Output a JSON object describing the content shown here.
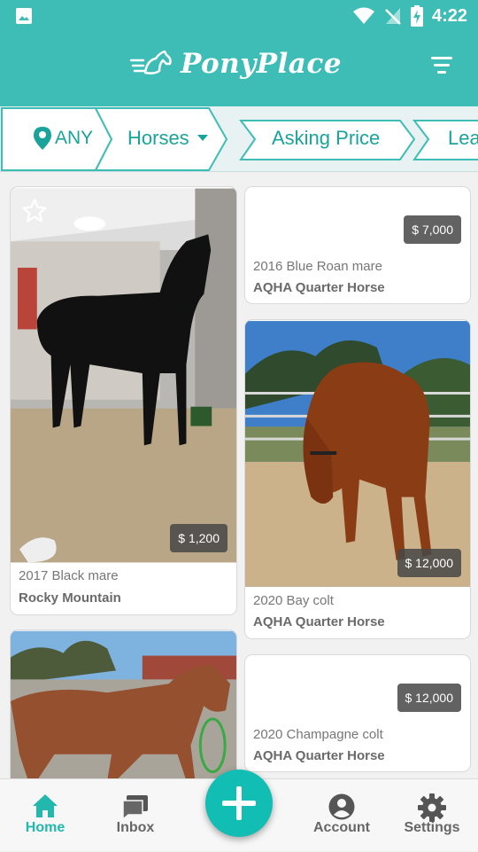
{
  "status": {
    "time": "4:22"
  },
  "app": {
    "name": "PonyPlace"
  },
  "filters": {
    "location": "ANY",
    "category": "Horses",
    "sort": "Asking Price",
    "next": "Lea"
  },
  "listings": [
    {
      "price": "$ 1,200",
      "meta": "2017 Black mare",
      "breed": "Rocky Mountain"
    },
    {
      "price": "$ 7,000",
      "meta": "2016 Blue Roan mare",
      "breed": "AQHA Quarter Horse"
    },
    {
      "price": "$ 12,000",
      "meta": "2020 Bay colt",
      "breed": "AQHA Quarter Horse"
    },
    {
      "price": "$ 12,000",
      "meta": "2020 Champagne colt",
      "breed": "AQHA Quarter Horse"
    }
  ],
  "nav": {
    "home": "Home",
    "inbox": "Inbox",
    "account": "Account",
    "settings": "Settings"
  },
  "colors": {
    "accent": "#3dbdb5",
    "fab": "#12bdb3"
  }
}
